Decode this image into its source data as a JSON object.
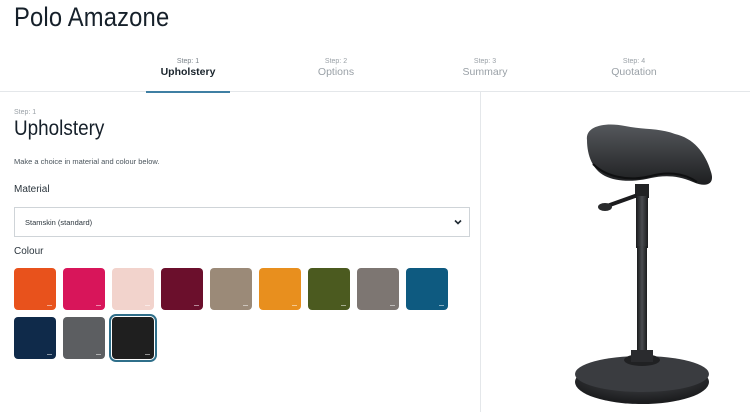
{
  "page": {
    "title": "Polo Amazone"
  },
  "steps": [
    {
      "num": "Step: 1",
      "label": "Upholstery",
      "active": true
    },
    {
      "num": "Step: 2",
      "label": "Options",
      "active": false
    },
    {
      "num": "Step: 3",
      "label": "Summary",
      "active": false
    },
    {
      "num": "Step: 4",
      "label": "Quotation",
      "active": false
    }
  ],
  "section": {
    "step": "Step: 1",
    "title": "Upholstery",
    "description": "Make a choice in material and colour below."
  },
  "material": {
    "label": "Material",
    "selected": "Stamskin (standard)",
    "icon": "chevron-down-icon"
  },
  "colour": {
    "label": "Colour",
    "swatches": [
      {
        "color": "#e8521c"
      },
      {
        "color": "#d8155a"
      },
      {
        "color": "#f2d3cc"
      },
      {
        "color": "#6b0f2c"
      },
      {
        "color": "#9b8a78"
      },
      {
        "color": "#e88f1e"
      },
      {
        "color": "#4b5a1f"
      },
      {
        "color": "#7d7672"
      },
      {
        "color": "#0e5a80"
      },
      {
        "color": "#0f2a4a"
      },
      {
        "color": "#5c5e61"
      },
      {
        "color": "#1f1f1f",
        "selected": true
      }
    ]
  },
  "colors": {
    "accent": "#3f7fa3",
    "selected_outline": "#2f6f8a"
  },
  "product_image": "saddle-stool-image"
}
